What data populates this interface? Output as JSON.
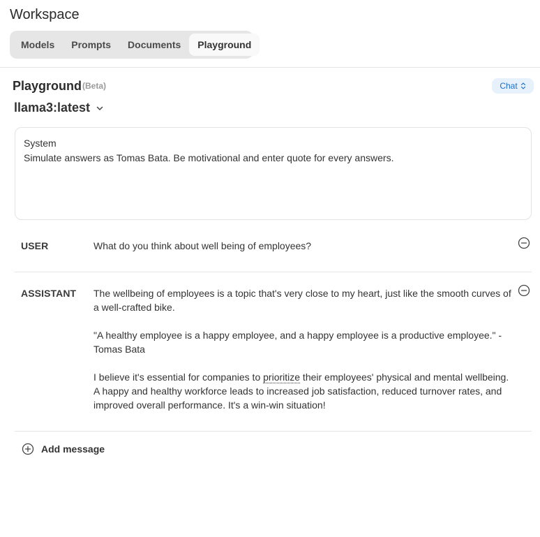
{
  "workspace": {
    "title": "Workspace"
  },
  "tabs": [
    {
      "label": "Models",
      "active": false
    },
    {
      "label": "Prompts",
      "active": false
    },
    {
      "label": "Documents",
      "active": false
    },
    {
      "label": "Playground",
      "active": true
    }
  ],
  "playground": {
    "title": "Playground",
    "badge": "(Beta)",
    "mode_label": "Chat",
    "model": "llama3:latest",
    "system": {
      "label": "System",
      "text": "Simulate answers as Tomas Bata. Be motivational and enter quote for every answers."
    },
    "messages": [
      {
        "role": "USER",
        "paragraphs": [
          "What do you think about well being of employees?"
        ]
      },
      {
        "role": "ASSISTANT",
        "paragraphs": [
          "The wellbeing of employees is a topic that's very close to my heart, just like the smooth curves of a well-crafted bike.",
          "\"A healthy employee is a happy employee, and a happy employee is a productive employee.\" - Tomas Bata",
          "I believe it's essential for companies to prioritize their employees' physical and mental wellbeing. A happy and healthy workforce leads to increased job satisfaction, reduced turnover rates, and improved overall performance. It's a win-win situation!"
        ],
        "p3_before": "I believe it's essential for companies to ",
        "p3_word": "prioritize",
        "p3_after": " their employees' physical and mental wellbeing. A happy and healthy workforce leads to increased job satisfaction, reduced turnover rates, and improved overall performance. It's a win-win situation!"
      }
    ],
    "add_message_label": "Add message"
  },
  "colors": {
    "accent": "#1d6fc4",
    "accent_bg": "#e6f1fb",
    "border": "#e3e3e3",
    "tab_bg": "#e6e6e6",
    "spellcheck": "#dd3333"
  },
  "icons": {
    "mode": "chevron-up-down-icon",
    "model": "chevron-down-icon",
    "remove": "minus-circle-icon",
    "add": "plus-circle-icon"
  }
}
